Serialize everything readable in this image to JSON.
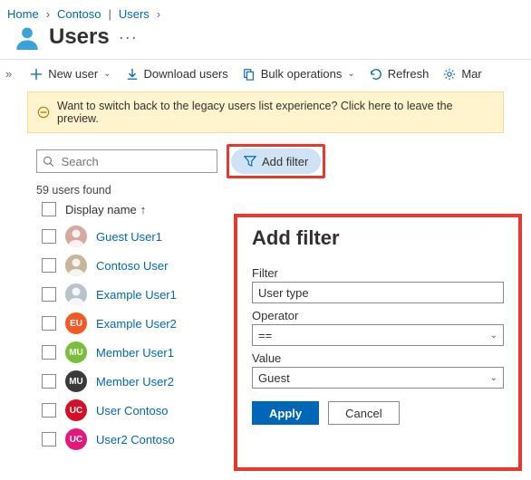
{
  "breadcrumb": {
    "home": "Home",
    "org": "Contoso",
    "blade": "Users"
  },
  "page": {
    "title": "Users",
    "more": "···"
  },
  "toolbar": {
    "expand": "»",
    "new_user": "New user",
    "download": "Download users",
    "bulk": "Bulk operations",
    "refresh": "Refresh",
    "manage": "Mar"
  },
  "notice": "Want to switch back to the legacy users list experience? Click here to leave the preview.",
  "search": {
    "placeholder": "Search"
  },
  "addfilter_button": "Add filter",
  "count_text": "59 users found",
  "columns": {
    "display_name": "Display name"
  },
  "sort_arrow": "↑",
  "users": [
    {
      "name": "Guest User1",
      "avatar_text": "",
      "avatar_bg": "#ffffff",
      "avatar_kind": "photo1"
    },
    {
      "name": "Contoso User",
      "avatar_text": "",
      "avatar_bg": "#ffffff",
      "avatar_kind": "photo2"
    },
    {
      "name": "Example User1",
      "avatar_text": "",
      "avatar_bg": "#ffffff",
      "avatar_kind": "photo3"
    },
    {
      "name": "Example User2",
      "avatar_text": "EU",
      "avatar_bg": "#f15a22",
      "avatar_kind": "initials"
    },
    {
      "name": "Member User1",
      "avatar_text": "MU",
      "avatar_bg": "#7abf3a",
      "avatar_kind": "initials"
    },
    {
      "name": "Member User2",
      "avatar_text": "MU",
      "avatar_bg": "#3a3a3a",
      "avatar_kind": "initials"
    },
    {
      "name": "User Contoso",
      "avatar_text": "UC",
      "avatar_bg": "#d40f26",
      "avatar_kind": "initials"
    },
    {
      "name": "User2 Contoso",
      "avatar_text": "UC",
      "avatar_bg": "#e6177a",
      "avatar_kind": "initials"
    }
  ],
  "filter_panel": {
    "heading": "Add filter",
    "filter_label": "Filter",
    "filter_value": "User type",
    "operator_label": "Operator",
    "operator_value": "==",
    "value_label": "Value",
    "value_value": "Guest",
    "apply": "Apply",
    "cancel": "Cancel"
  }
}
